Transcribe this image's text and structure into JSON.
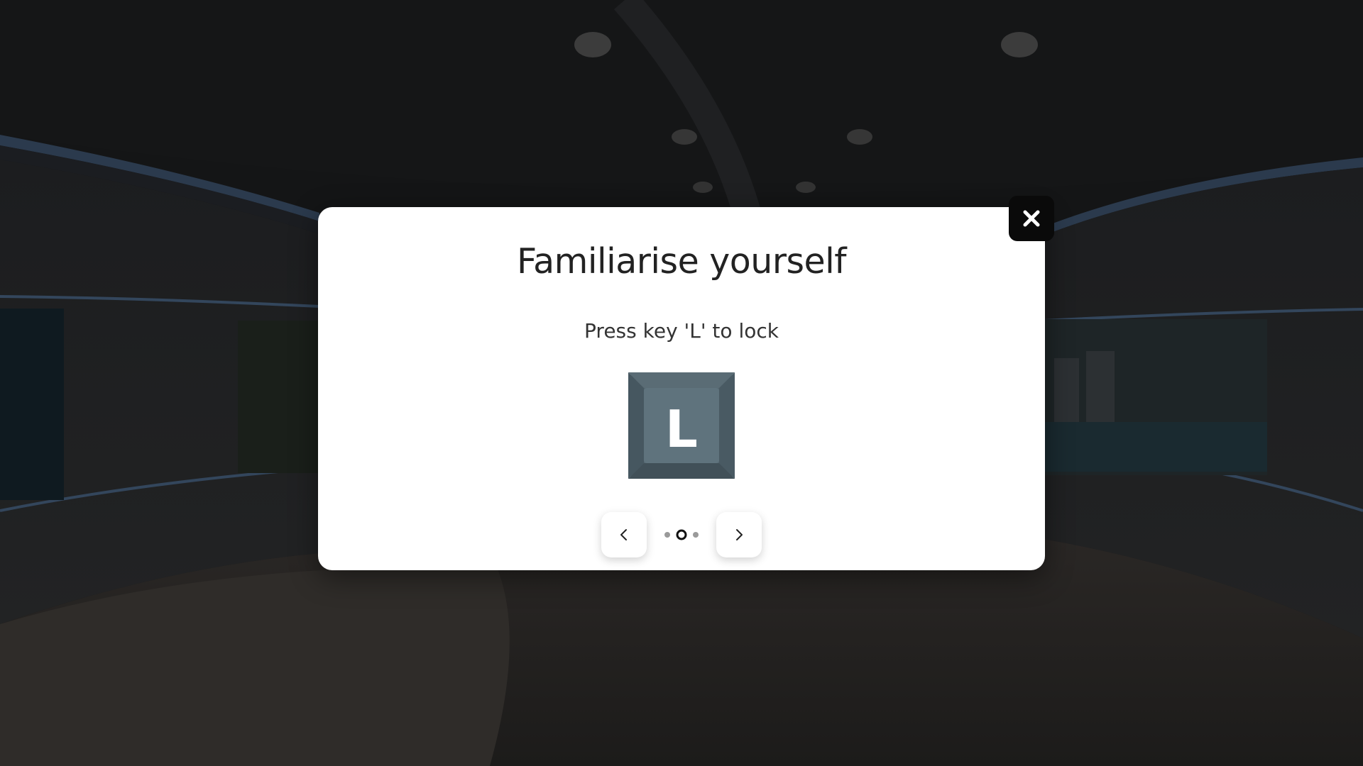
{
  "modal": {
    "title": "Familiarise yourself",
    "subtitle": "Press key 'L' to lock",
    "key_letter": "L"
  },
  "pagination": {
    "total_steps": 3,
    "current_step": 2
  },
  "icons": {
    "close": "close-icon",
    "prev": "chevron-left-icon",
    "next": "chevron-right-icon",
    "key": "keyboard-key-icon"
  },
  "colors": {
    "key_fill": "#53656e",
    "key_face": "#5f737d",
    "key_text": "#ffffff",
    "close_bg": "#0a0a0a"
  }
}
